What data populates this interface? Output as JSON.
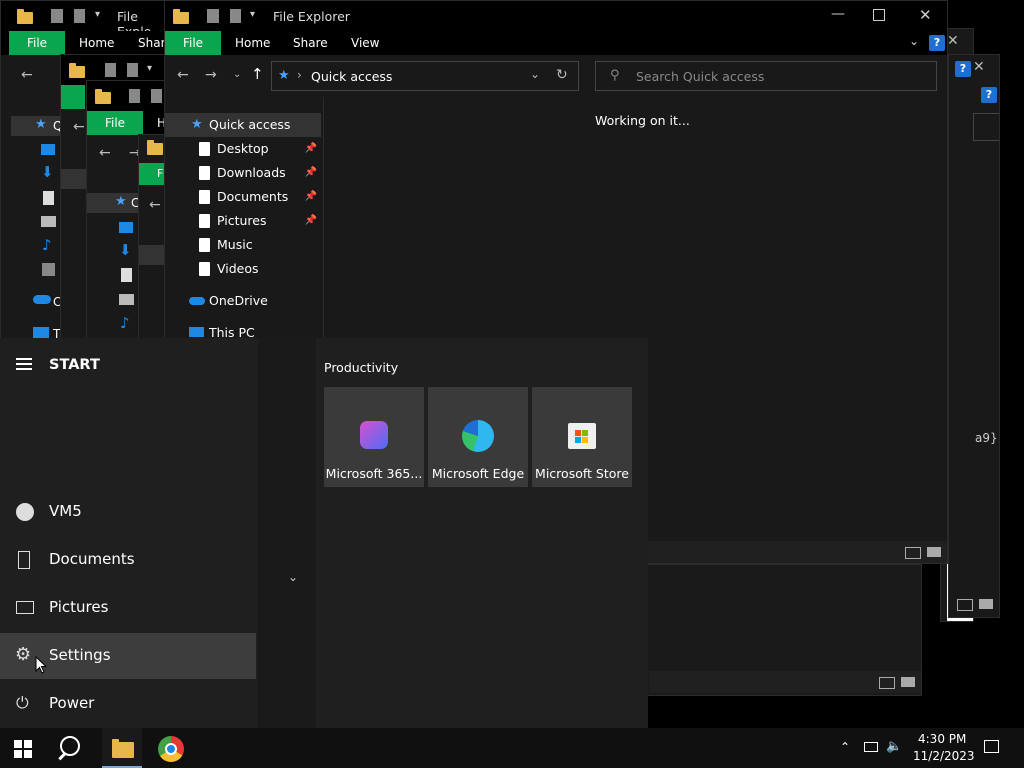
{
  "explorer": {
    "title": "File Explorer",
    "title_truncated": "File Explo",
    "ribbon": {
      "file": "File",
      "home": "Home",
      "share": "Share",
      "view": "View"
    },
    "address": "Quick access",
    "search_placeholder": "Search Quick access",
    "status_message": "Working on it...",
    "nav": {
      "quick_access": "Quick access",
      "items": [
        {
          "label": "Desktop",
          "pinned": true
        },
        {
          "label": "Downloads",
          "pinned": true
        },
        {
          "label": "Documents",
          "pinned": true
        },
        {
          "label": "Pictures",
          "pinned": true
        },
        {
          "label": "Music",
          "pinned": false
        },
        {
          "label": "Videos",
          "pinned": false
        }
      ],
      "onedrive": "OneDrive",
      "this_pc": "This PC"
    }
  },
  "background_windows": {
    "file_tab": "File",
    "home_tab_partial": "H",
    "share_tab_partial": "Share",
    "f_tab_partial": "F",
    "nav_partial_q": "Q",
    "nav_partial_c": "C",
    "nav_partial_t": "T",
    "right_text_partial": "a9}"
  },
  "start_menu": {
    "header": "START",
    "user": "VM5",
    "items": [
      "Documents",
      "Pictures",
      "Settings",
      "Power"
    ],
    "group_title": "Productivity",
    "tiles": [
      {
        "label": "Microsoft 365...",
        "icon": "microsoft-365-icon"
      },
      {
        "label": "Microsoft Edge",
        "icon": "edge-icon"
      },
      {
        "label": "Microsoft Store",
        "icon": "store-icon"
      }
    ]
  },
  "taskbar": {
    "time": "4:30 PM",
    "date": "11/2/2023"
  },
  "colors": {
    "ribbon_file": "#0aa64f",
    "accent_blue": "#1e88e5",
    "folder": "#e8b74a"
  }
}
